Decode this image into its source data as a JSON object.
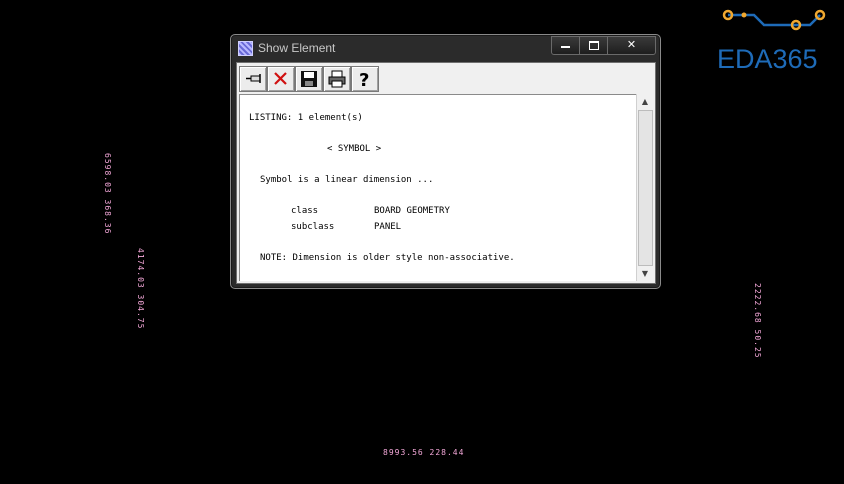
{
  "window": {
    "title": "Show Element"
  },
  "toolbar": {
    "buttons": [
      "pin-icon",
      "close-x-icon",
      "save-icon",
      "print-icon",
      "help-icon"
    ]
  },
  "listing": {
    "header": "LISTING: 1 element(s)",
    "section": "< SYMBOL >",
    "description": "Symbol is a linear dimension ...",
    "class_label": "class",
    "class_value": "BOARD GEOMETRY",
    "subclass_label": "subclass",
    "subclass_value": "PANEL",
    "note": "NOTE: Dimension is older style non-associative."
  },
  "canvas": {
    "dim_labels": [
      "6598.03  368.36",
      "4174.03  304.75",
      "2222.68  50.25",
      "8993.56  228.44"
    ]
  },
  "logo": {
    "text": "EDA365",
    "color": "#1e6bb8",
    "accent": "#f0a830"
  }
}
